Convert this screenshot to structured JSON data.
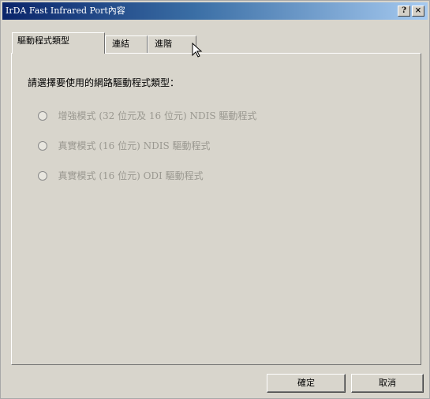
{
  "window": {
    "title": "IrDA Fast Infrared Port內容",
    "help_glyph": "?",
    "close_glyph": "×"
  },
  "tabs": [
    {
      "label": "驅動程式類型",
      "active": true
    },
    {
      "label": "連結",
      "active": false
    },
    {
      "label": "進階",
      "active": false
    }
  ],
  "panel": {
    "prompt": "請選擇要使用的網路驅動程式類型：",
    "options": [
      {
        "label": "增強模式 (32 位元及 16 位元) NDIS 驅動程式",
        "enabled": false
      },
      {
        "label": "真實模式 (16 位元) NDIS 驅動程式",
        "enabled": false
      },
      {
        "label": "真實模式 (16 位元) ODI 驅動程式",
        "enabled": false
      }
    ]
  },
  "buttons": {
    "ok": "確定",
    "cancel": "取消"
  },
  "icons": {
    "help": "help-icon",
    "close": "close-icon",
    "cursor": "mouse-pointer-icon"
  }
}
